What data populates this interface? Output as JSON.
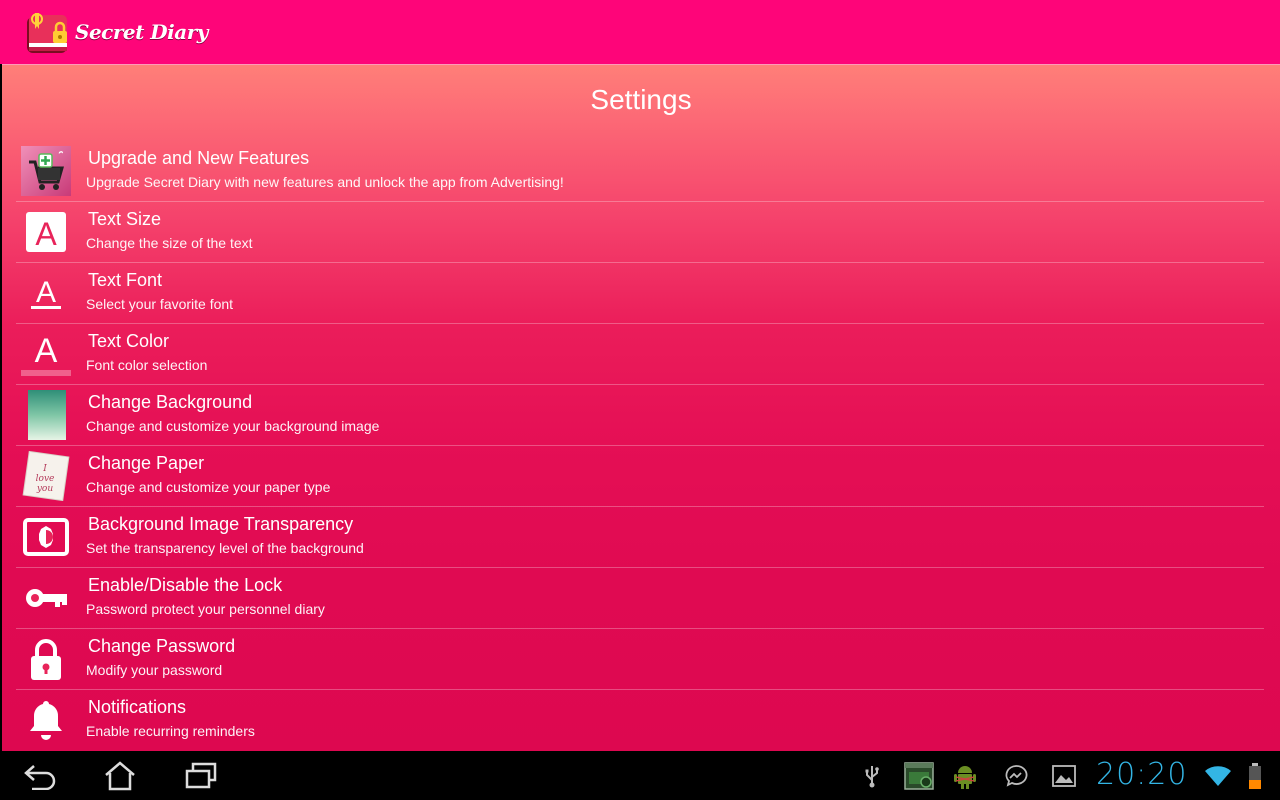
{
  "app": {
    "title": "Secret Diary",
    "accent_color": "#fe0579"
  },
  "page": {
    "title": "Settings"
  },
  "settings": [
    {
      "icon": "shopping-cart-icon",
      "title": "Upgrade and New Features",
      "subtitle": "Upgrade Secret Diary with new features and unlock the app from Advertising!"
    },
    {
      "icon": "text-size-icon",
      "title": "Text Size",
      "subtitle": "Change the size of the text"
    },
    {
      "icon": "text-font-icon",
      "title": "Text Font",
      "subtitle": "Select your favorite font"
    },
    {
      "icon": "text-color-icon",
      "title": "Text Color",
      "subtitle": "Font color selection"
    },
    {
      "icon": "background-image-icon",
      "title": "Change Background",
      "subtitle": "Change and customize your background image"
    },
    {
      "icon": "paper-note-icon",
      "title": "Change Paper",
      "subtitle": "Change and customize your paper type"
    },
    {
      "icon": "brightness-icon",
      "title": "Background Image Transparency",
      "subtitle": "Set the transparency level of the background"
    },
    {
      "icon": "key-icon",
      "title": "Enable/Disable the Lock",
      "subtitle": "Password protect your personnel diary"
    },
    {
      "icon": "padlock-icon",
      "title": "Change Password",
      "subtitle": "Modify your password"
    },
    {
      "icon": "bell-icon",
      "title": "Notifications",
      "subtitle": "Enable recurring reminders"
    }
  ],
  "paper_note_text": "I love you",
  "system_bar": {
    "clock": "20:20",
    "nav_icons": [
      "back-icon",
      "home-icon",
      "recent-apps-icon"
    ],
    "tray_icons": [
      "usb-icon",
      "screenshot-icon",
      "android-debug-icon",
      "messenger-icon",
      "gallery-icon",
      "wifi-icon",
      "battery-icon"
    ]
  }
}
